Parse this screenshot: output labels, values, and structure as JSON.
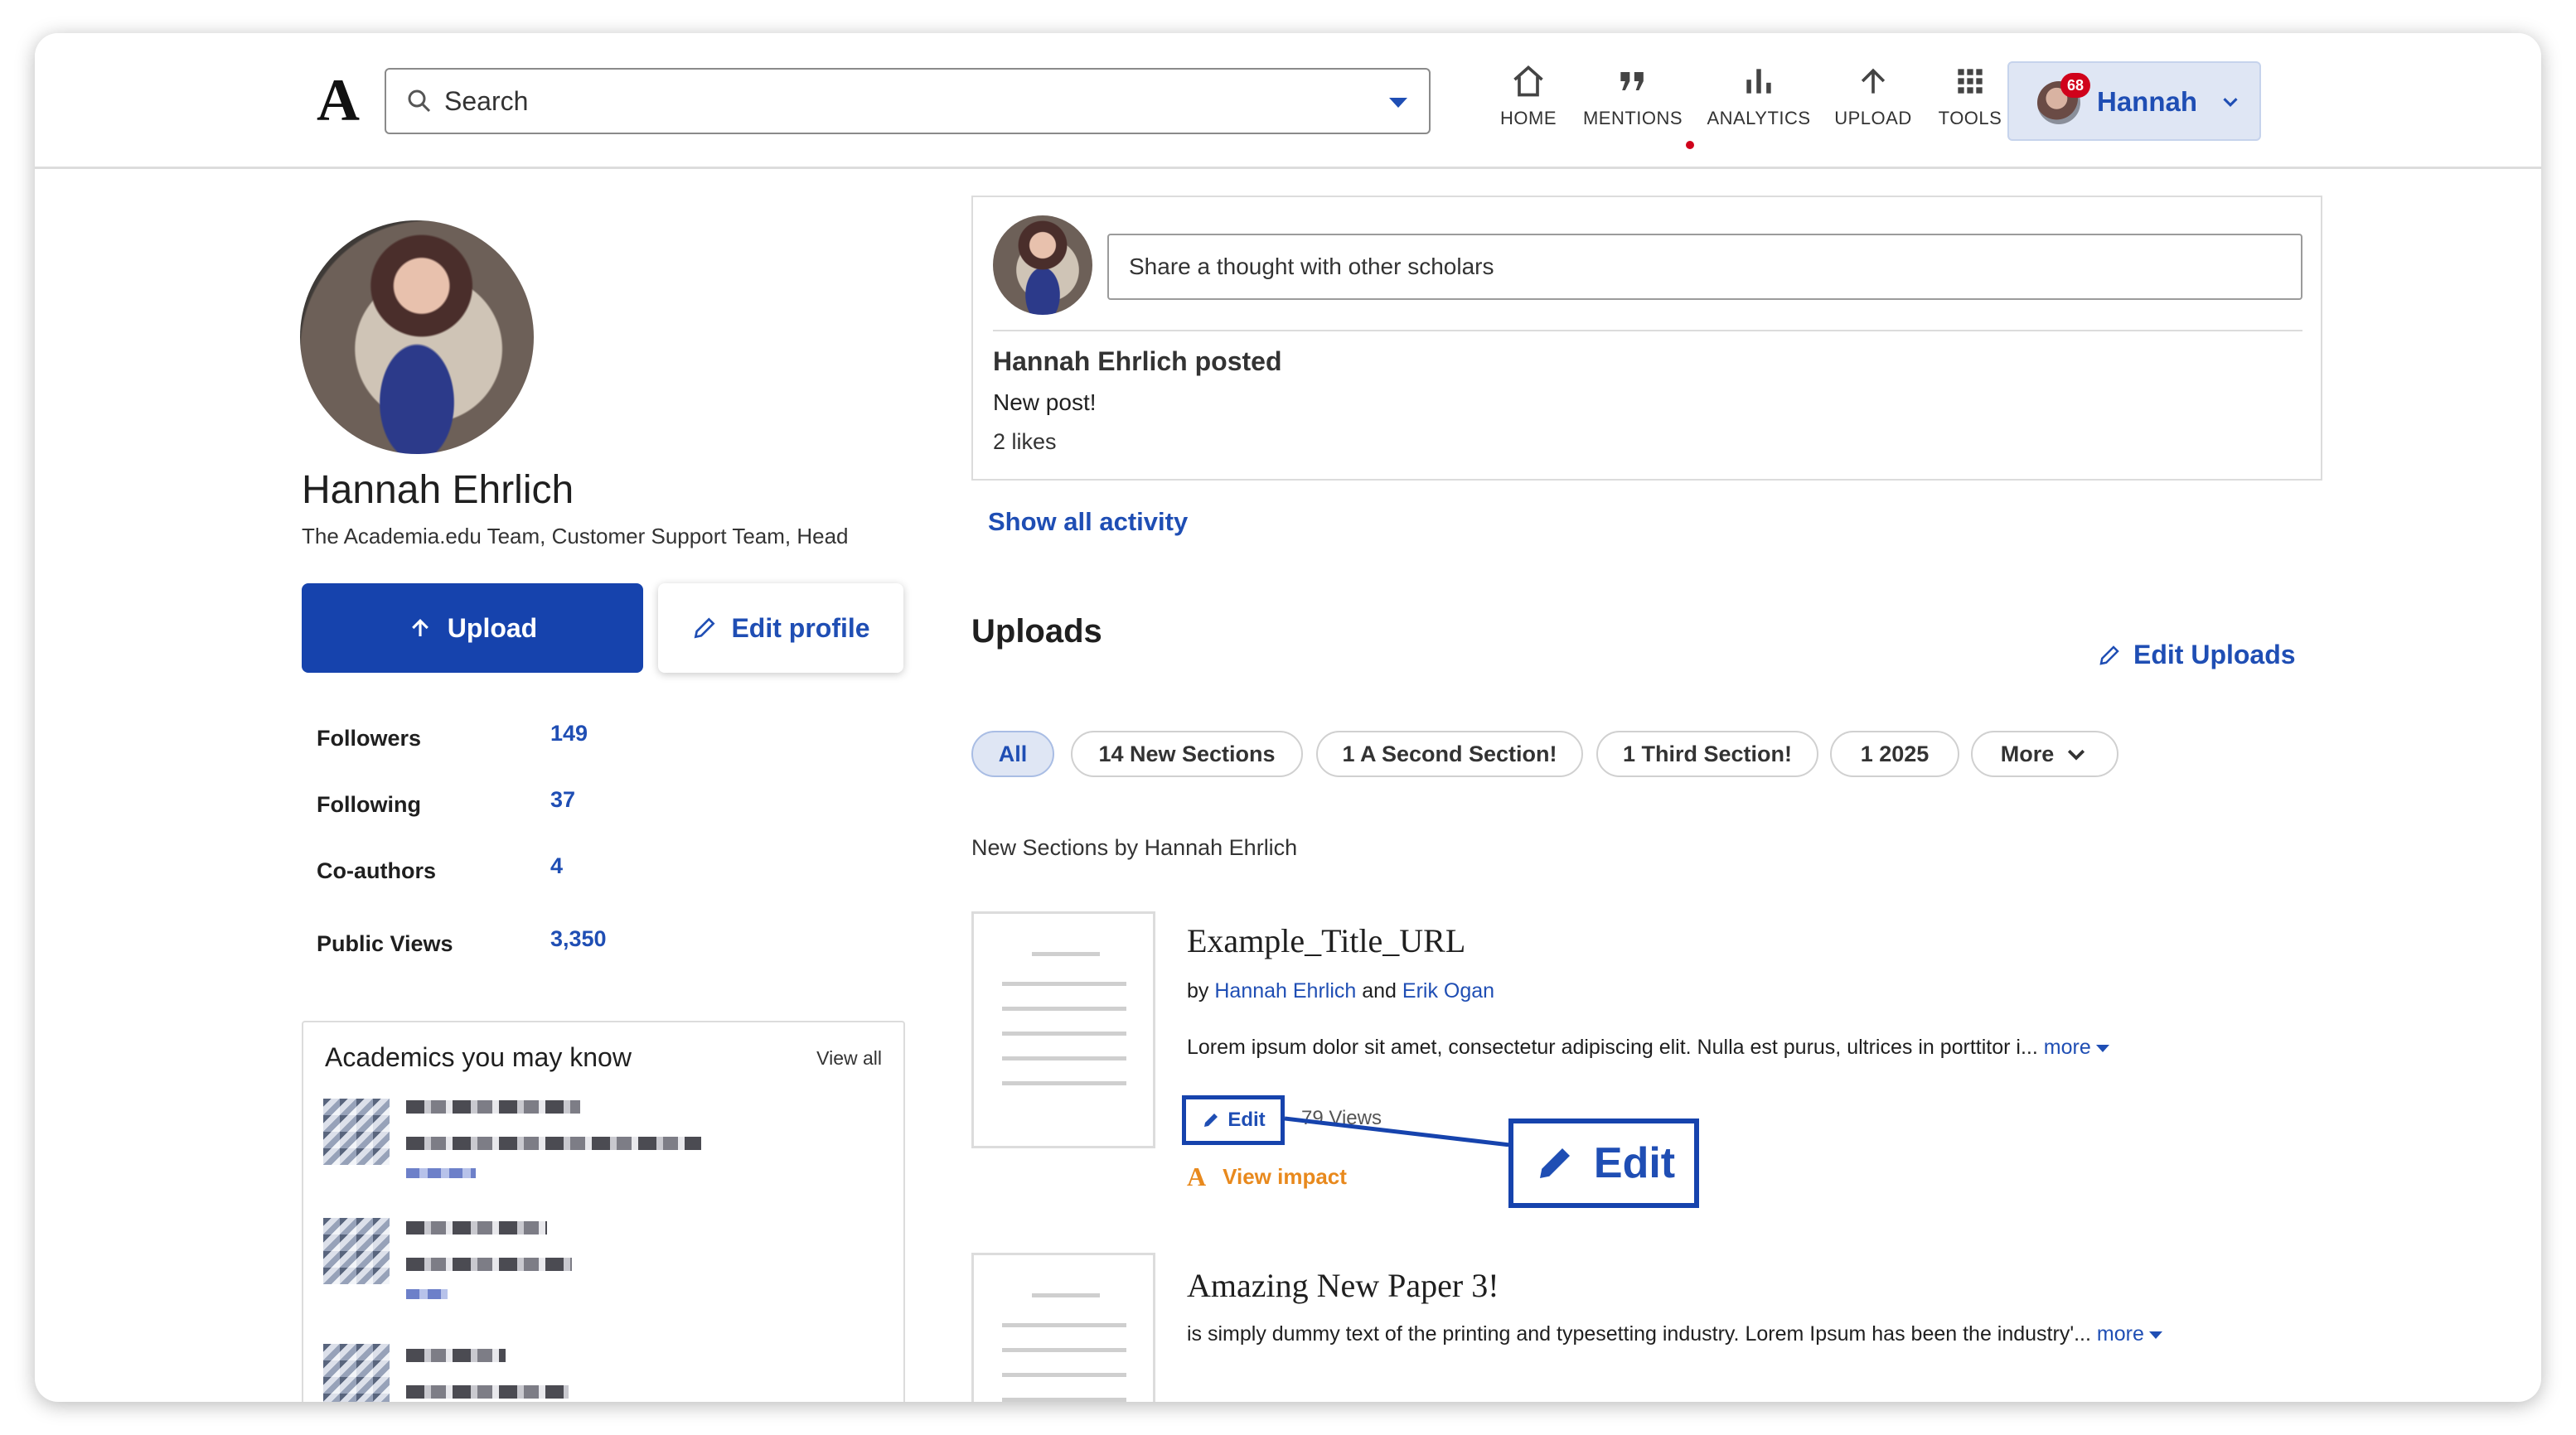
{
  "header": {
    "logo": "A",
    "search_placeholder": "Search",
    "nav": [
      {
        "label": "HOME",
        "icon": "home-icon"
      },
      {
        "label": "MENTIONS",
        "icon": "quote-icon"
      },
      {
        "label": "ANALYTICS",
        "icon": "bar-chart-icon"
      },
      {
        "label": "UPLOAD",
        "icon": "arrow-up-icon"
      },
      {
        "label": "TOOLS",
        "icon": "grid-icon"
      }
    ],
    "user": {
      "name": "Hannah",
      "notifications": "68"
    }
  },
  "profile": {
    "name": "Hannah Ehrlich",
    "affiliation": "The Academia.edu Team, Customer Support Team, Head",
    "upload_label": "Upload",
    "edit_label": "Edit profile",
    "stats": [
      {
        "label": "Followers",
        "value": "149"
      },
      {
        "label": "Following",
        "value": "37"
      },
      {
        "label": "Co-authors",
        "value": "4"
      },
      {
        "label": "Public Views",
        "value": "3,350"
      }
    ]
  },
  "suggestions": {
    "title": "Academics you may know",
    "view_all": "View all"
  },
  "composer": {
    "placeholder": "Share a thought with other scholars",
    "post_byline": "Hannah Ehrlich posted",
    "post_text": "New post!",
    "likes": "2 likes"
  },
  "activity_link": "Show all activity",
  "uploads": {
    "title": "Uploads",
    "edit_label": "Edit Uploads",
    "filters": [
      "All",
      "14 New Sections",
      "1 A Second Section!",
      "1 Third Section!",
      "1 2025",
      "More"
    ],
    "section_heading": "New Sections by Hannah Ehrlich",
    "papers": [
      {
        "title": "Example_Title_URL",
        "by": "by",
        "author1": "Hannah Ehrlich",
        "and": "and",
        "author2": "Erik Ogan",
        "abstract": "Lorem ipsum dolor sit amet, consectetur adipiscing elit. Nulla est purus, ultrices in porttitor i...",
        "more": "more",
        "edit": "Edit",
        "views": "79 Views",
        "impact": "View impact"
      },
      {
        "title": "Amazing New Paper 3!",
        "abstract": "is simply dummy text of the printing and typesetting industry. Lorem Ipsum has been the industry'...",
        "more": "more"
      }
    ]
  },
  "callout": {
    "label": "Edit"
  },
  "colors": {
    "brand": "#1643ad",
    "link": "#1f4eb4",
    "impact": "#e8891d",
    "alert": "#d0021b"
  }
}
